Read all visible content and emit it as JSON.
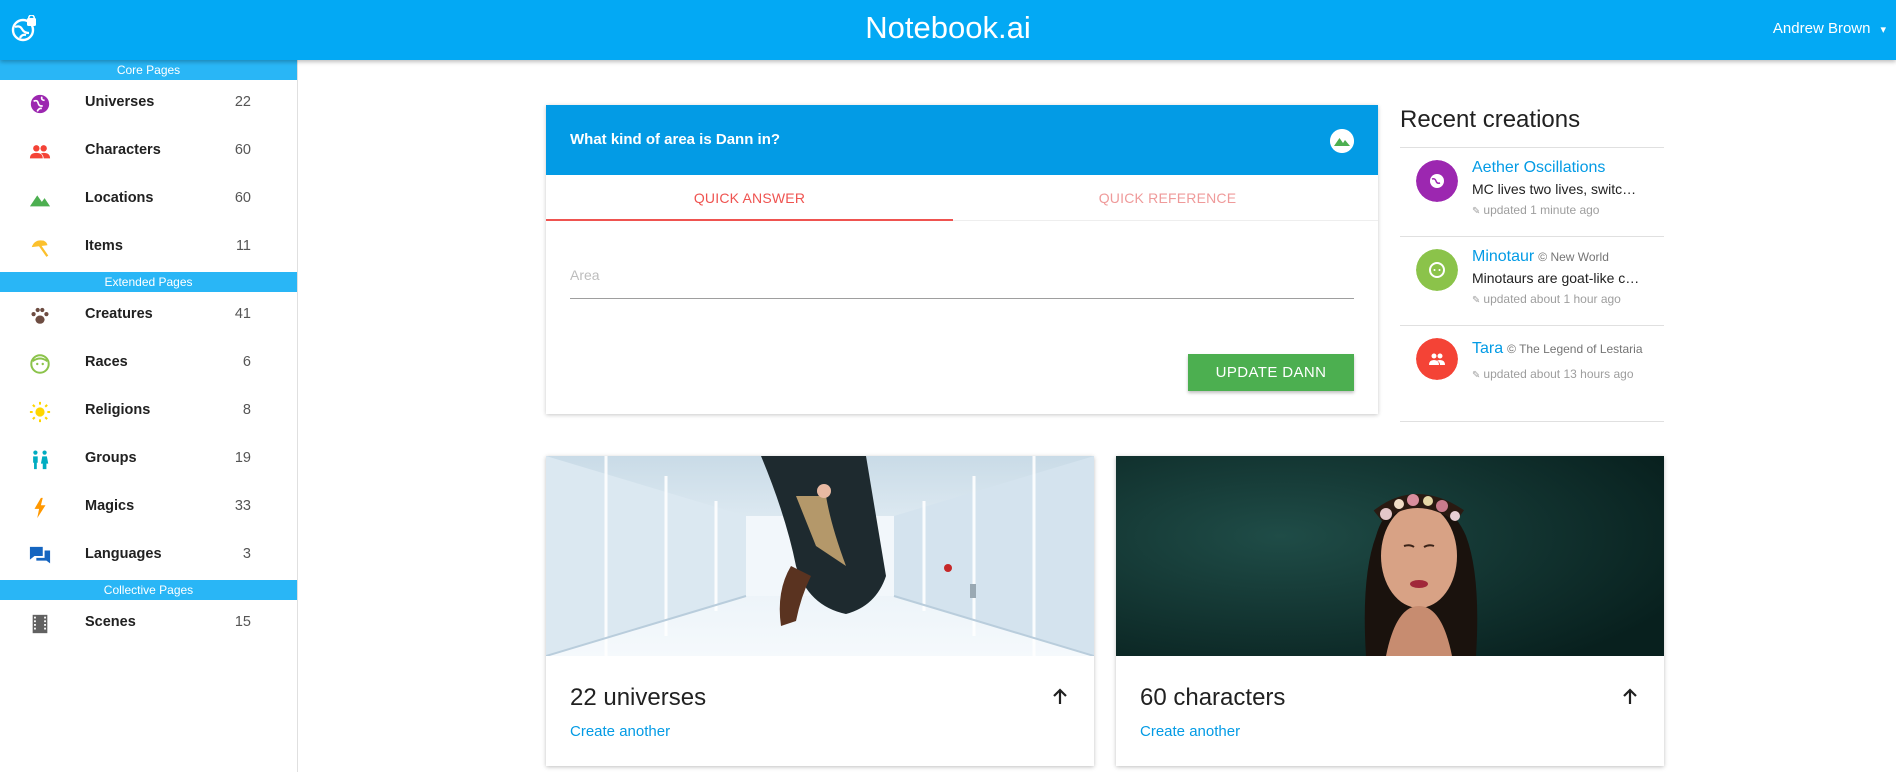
{
  "app": {
    "brand": "Notebook.ai",
    "user_name": "Andrew Brown",
    "user_caret": "▾"
  },
  "sidebar": {
    "sections": [
      {
        "header": "Core Pages",
        "items": [
          {
            "label": "Universes",
            "count": "22",
            "icon": "globe-icon",
            "color": "#9c27b0"
          },
          {
            "label": "Characters",
            "count": "60",
            "icon": "people-icon",
            "color": "#f44336"
          },
          {
            "label": "Locations",
            "count": "60",
            "icon": "terrain-icon",
            "color": "#4caf50"
          },
          {
            "label": "Items",
            "count": "11",
            "icon": "beach-umbrella-icon",
            "color": "#fbc02d"
          }
        ]
      },
      {
        "header": "Extended Pages",
        "items": [
          {
            "label": "Creatures",
            "count": "41",
            "icon": "paw-icon",
            "color": "#6d4c41"
          },
          {
            "label": "Races",
            "count": "6",
            "icon": "face-icon",
            "color": "#8bc34a"
          },
          {
            "label": "Religions",
            "count": "8",
            "icon": "sun-icon",
            "color": "#ffd600"
          },
          {
            "label": "Groups",
            "count": "19",
            "icon": "group-icon",
            "color": "#00acc1"
          },
          {
            "label": "Magics",
            "count": "33",
            "icon": "lightning-icon",
            "color": "#ff9800"
          },
          {
            "label": "Languages",
            "count": "3",
            "icon": "chat-icon",
            "color": "#1565c0"
          }
        ]
      },
      {
        "header": "Collective Pages",
        "items": [
          {
            "label": "Scenes",
            "count": "15",
            "icon": "film-icon",
            "color": "#616161"
          }
        ]
      }
    ]
  },
  "prompt": {
    "question": "What kind of area is Dann in?",
    "tab_answer": "QUICK ANSWER",
    "tab_reference": "QUICK REFERENCE",
    "field_placeholder": "Area",
    "field_value": "",
    "button_label": "UPDATE DANN",
    "header_color": "#039be5",
    "button_color": "#4caf50"
  },
  "recent": {
    "title": "Recent creations",
    "items": [
      {
        "name": "Aether Oscillations",
        "universe": "",
        "desc": "MC lives two lives, switching between them...",
        "updated": "updated 1 minute ago",
        "icon": "globe-icon",
        "color": "#9c27b0"
      },
      {
        "name": "Minotaur",
        "universe": "New World",
        "desc": "Minotaurs are goat-like creatures...",
        "updated": "updated about 1 hour ago",
        "icon": "face-icon",
        "color": "#8bc34a"
      },
      {
        "name": "Tara",
        "universe": "The Legend of Lestaria",
        "desc": "",
        "updated": "updated about 13 hours ago",
        "icon": "people-icon",
        "color": "#f44336"
      }
    ]
  },
  "stats": [
    {
      "title": "22 universes",
      "link": "Create another"
    },
    {
      "title": "60 characters",
      "link": "Create another"
    }
  ]
}
